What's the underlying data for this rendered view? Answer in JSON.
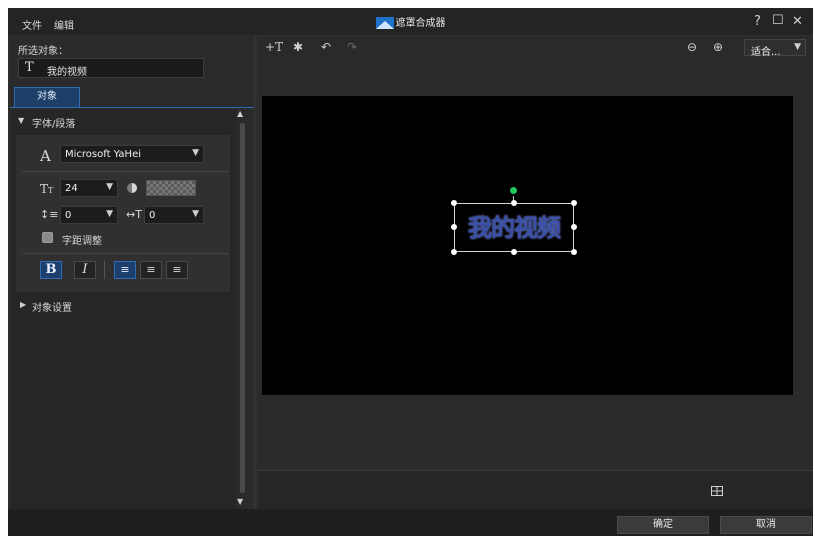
{
  "menu": [
    "文件",
    "编辑"
  ],
  "window": {
    "title": "遮罩合成器",
    "help": "?",
    "maximize": "☐",
    "close": "✕"
  },
  "left": {
    "selected_label": "所选对象：",
    "selected_value": "我的视频",
    "tab": "对象",
    "section_font": "字体/段落",
    "font_name": "Microsoft YaHei",
    "font_size": "24",
    "line_spacing": "0",
    "char_spacing": "0",
    "kerning_label": "字距调整",
    "section_object": "对象设置"
  },
  "canvas": {
    "text": "我的视频"
  },
  "zoom": {
    "fit_label": "适合..."
  },
  "footer": {
    "ok": "确定",
    "cancel": "取消"
  },
  "colors": {
    "accent": "#2f6bb3",
    "bg": "#2e2e2e",
    "canvas": "#000000",
    "text_fill": "#3a4fa8"
  }
}
